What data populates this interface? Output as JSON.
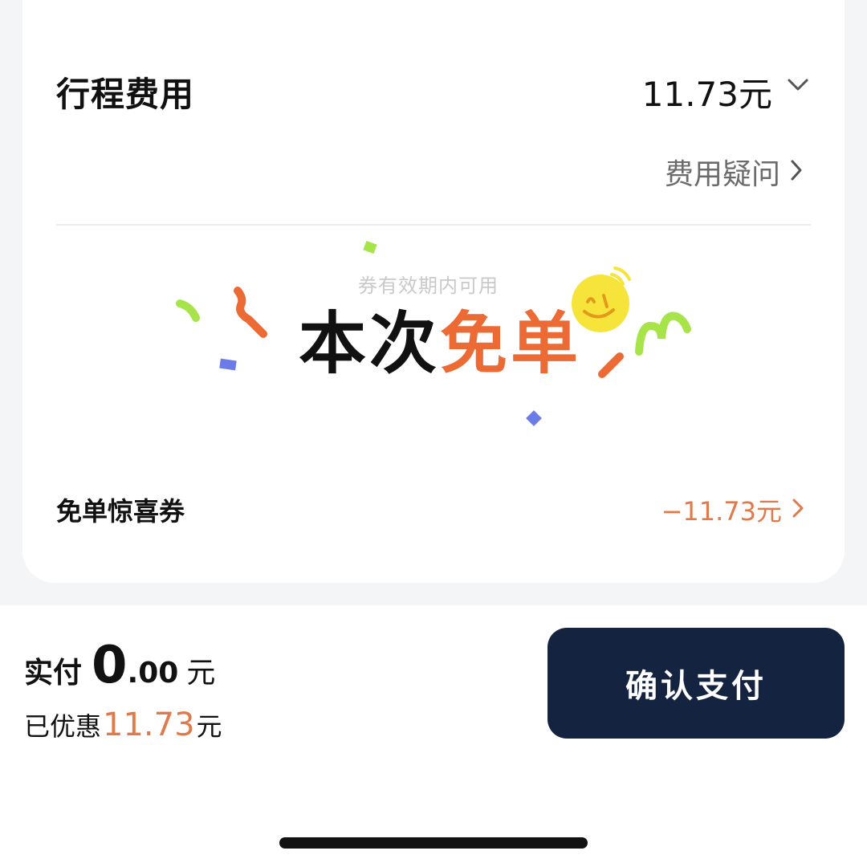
{
  "fare": {
    "title": "行程费用",
    "amount": "11.73元",
    "question_link": "费用疑问"
  },
  "banner": {
    "hint": "券有效期内可用",
    "text_black": "本次",
    "text_orange": "免单"
  },
  "coupon": {
    "name": "免单惊喜券",
    "amount": "−11.73元"
  },
  "payment": {
    "paid_label": "实付",
    "paid_int": "0",
    "paid_dec": ".00",
    "paid_unit": "元",
    "discount_label": "已优惠",
    "discount_value": "11.73",
    "discount_unit": "元",
    "button_label": "确认支付"
  },
  "colors": {
    "accent_orange": "#ec6a33",
    "button_navy": "#14233f",
    "confetti_green": "#a6e44a",
    "confetti_blue": "#6b7be8",
    "emoji_yellow": "#f7e43a"
  }
}
